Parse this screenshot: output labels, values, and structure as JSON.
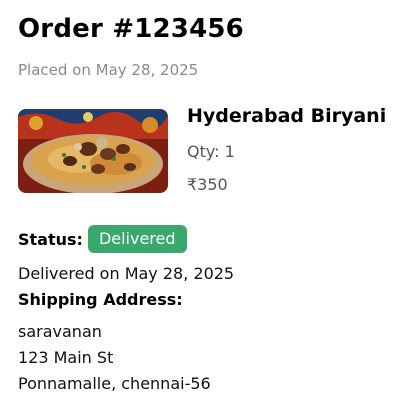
{
  "order": {
    "title": "Order #123456",
    "placed_on": "Placed on May 28, 2025"
  },
  "item": {
    "name": "Hyderabad Biryani",
    "quantity": "Qty: 1",
    "price": "₹350",
    "image": "biryani-photo"
  },
  "status": {
    "label": "Status:",
    "badge": "Delivered",
    "badge_color": "#3aa76d",
    "delivered_on": "Delivered on May 28, 2025"
  },
  "shipping": {
    "heading": "Shipping Address:",
    "lines": [
      "saravanan",
      "123 Main St",
      "Ponnamalle, chennai-56"
    ]
  }
}
